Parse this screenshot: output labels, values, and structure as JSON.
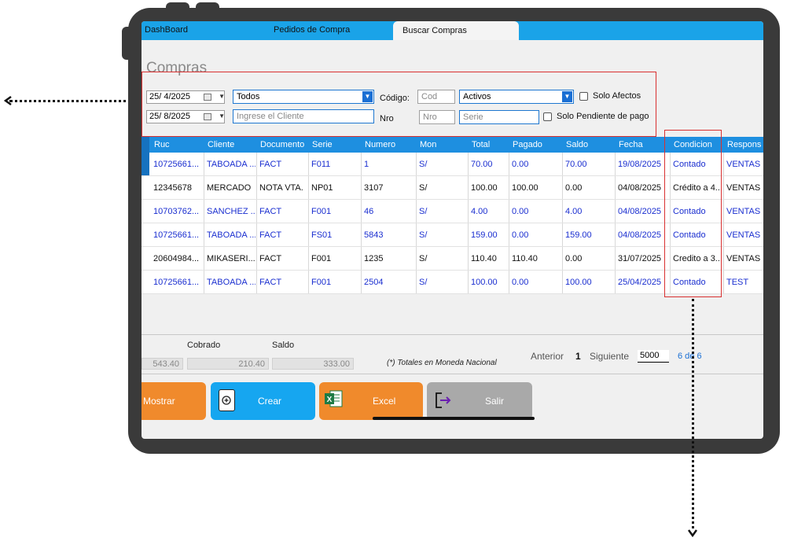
{
  "tabs": [
    "DashBoard",
    "Pedidos de Compra",
    "Buscar Compras"
  ],
  "page_title": "Compras",
  "filters": {
    "date_from": "25/ 4/2025",
    "date_to": "25/ 8/2025",
    "type_select": "Todos",
    "client_placeholder": "Ingrese el Cliente",
    "codigo_label": "Código:",
    "cod_placeholder": "Cod",
    "estado_select": "Activos",
    "solo_afectos": "Solo Afectos",
    "nro_label": "Nro",
    "nro_placeholder": "Nro",
    "serie_placeholder": "Serie",
    "solo_pendiente": "Solo Pendiente de pago"
  },
  "grid": {
    "headers": [
      "Ruc",
      "Cliente",
      "Documento",
      "Serie",
      "Numero",
      "Mon",
      "Total",
      "Pagado",
      "Saldo",
      "Fecha",
      "Condicion",
      "Respons"
    ],
    "rows": [
      {
        "style": "blue",
        "cells": [
          "10725661...",
          "TABOADA ...",
          "FACT",
          "F011",
          "1",
          "S/",
          "70.00",
          "0.00",
          "70.00",
          "19/08/2025",
          "Contado",
          "VENTAS R"
        ]
      },
      {
        "style": "dark",
        "cells": [
          "12345678",
          "MERCADO",
          "NOTA VTA.",
          "NP01",
          "3107",
          "S/",
          "100.00",
          "100.00",
          "0.00",
          "04/08/2025",
          "Crédito a 4...",
          "VENTAS R"
        ]
      },
      {
        "style": "blue",
        "cells": [
          "10703762...",
          "SANCHEZ ...",
          "FACT",
          "F001",
          "46",
          "S/",
          "4.00",
          "0.00",
          "4.00",
          "04/08/2025",
          "Contado",
          "VENTAS R"
        ]
      },
      {
        "style": "blue",
        "cells": [
          "10725661...",
          "TABOADA ...",
          "FACT",
          "FS01",
          "5843",
          "S/",
          "159.00",
          "0.00",
          "159.00",
          "04/08/2025",
          "Contado",
          "VENTAS R"
        ]
      },
      {
        "style": "dark",
        "cells": [
          "20604984...",
          "MIKASERI...",
          "FACT",
          "F001",
          "1235",
          "S/",
          "110.40",
          "110.40",
          "0.00",
          "31/07/2025",
          "Credito a 3...",
          "VENTAS R"
        ]
      },
      {
        "style": "blue",
        "cells": [
          "10725661...",
          "TABOADA ...",
          "FACT",
          "F001",
          "2504",
          "S/",
          "100.00",
          "0.00",
          "100.00",
          "25/04/2025",
          "Contado",
          "TEST"
        ]
      }
    ]
  },
  "totals": {
    "total_value": "543.40",
    "cobrado_label": "Cobrado",
    "cobrado_value": "210.40",
    "saldo_label": "Saldo",
    "saldo_value": "333.00",
    "note": "(*) Totales en Moneda Nacional"
  },
  "pager": {
    "anterior": "Anterior",
    "page": "1",
    "siguiente": "Siguiente",
    "page_size": "5000",
    "count": "6 de 6"
  },
  "buttons": {
    "mostrar": "Mostrar",
    "crear": "Crear",
    "excel": "Excel",
    "salir": "Salir"
  },
  "colors": {
    "tab_bar": "#1aa3e8",
    "grid_header": "#1e8fe0",
    "mostrar": "#f08a2c",
    "crear": "#16a6f0",
    "excel": "#f08a2c",
    "salir": "#a9a9a9",
    "highlight": "#d93030"
  }
}
